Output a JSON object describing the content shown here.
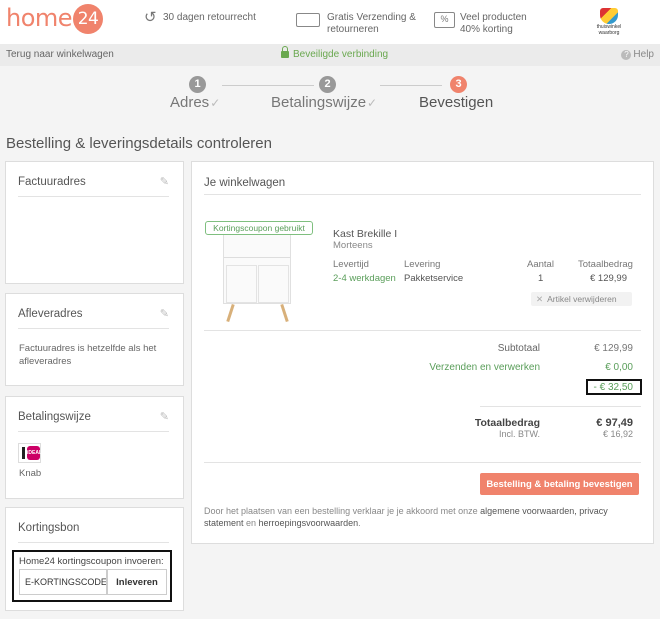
{
  "header": {
    "logo_text": "home",
    "logo_number": "24",
    "usps": [
      {
        "icon": "return-arrow-icon",
        "line1": "30 dagen retourrecht",
        "line2": ""
      },
      {
        "icon": "truck-icon",
        "line1": "Gratis Verzending &",
        "line2": "retourneren"
      },
      {
        "icon": "percent-tag-icon",
        "line1": "Veel producten",
        "line2": "40% korting"
      }
    ],
    "trust_badge_line1": "thuiswinkel",
    "trust_badge_line2": "waarborg"
  },
  "subbar": {
    "back_link": "Terug naar winkelwagen",
    "secure": "Beveiligde verbinding",
    "help": "Help"
  },
  "steps": [
    {
      "num": "1",
      "label": "Adres",
      "check": "✓",
      "state": "done"
    },
    {
      "num": "2",
      "label": "Betalingswijze",
      "check": "✓",
      "state": "done"
    },
    {
      "num": "3",
      "label": "Bevestigen",
      "check": "",
      "state": "active"
    }
  ],
  "page_title": "Bestelling & leveringsdetails controleren",
  "boxes": {
    "invoice": {
      "title": "Factuuradres"
    },
    "delivery": {
      "title": "Afleveradres",
      "line1": "Factuuradres is hetzelfde als het",
      "line2": "afleveradres"
    },
    "payment": {
      "title": "Betalingswijze",
      "method": "Knab",
      "ideal_label": "iDEAL"
    },
    "voucher": {
      "title": "Kortingsbon",
      "label": "Home24 kortingscoupon invoeren:",
      "input_value": "E-KORTINGSCODE",
      "button": "Inleveren"
    }
  },
  "cart": {
    "title": "Je winkelwagen",
    "coupon_badge": "Kortingscoupon gebruikt",
    "product": {
      "name": "Kast Brekille I",
      "brand": "Morteens",
      "headers": {
        "time": "Levertijd",
        "delivery": "Levering",
        "qty": "Aantal",
        "total": "Totaalbedrag"
      },
      "values": {
        "time": "2-4 werkdagen",
        "delivery": "Pakketservice",
        "qty": "1",
        "total": "€ 129,99"
      },
      "remove": "Artikel verwijderen"
    },
    "summary": {
      "subtotal_label": "Subtotaal",
      "subtotal_value": "€ 129,99",
      "shipping_label": "Verzenden en verwerken",
      "shipping_value": "€ 0,00",
      "discount_value": "- € 32,50",
      "total_label": "Totaalbedrag",
      "vat_label": "Incl. BTW.",
      "total_value": "€ 97,49",
      "vat_value": "€ 16,92"
    },
    "confirm_button": "Bestelling & betaling bevestigen",
    "terms_pre": "Door het plaatsen van een bestelling verklaar je je akkoord met onze ",
    "terms_link1": "algemene voorwaarden, privacy statement",
    "terms_mid": " en ",
    "terms_link2": "herroepingsvoorwaarden",
    "terms_post": "."
  },
  "colors": {
    "brand": "#f0836c",
    "green": "#5a9e5a",
    "background": "#f4f4f4"
  }
}
